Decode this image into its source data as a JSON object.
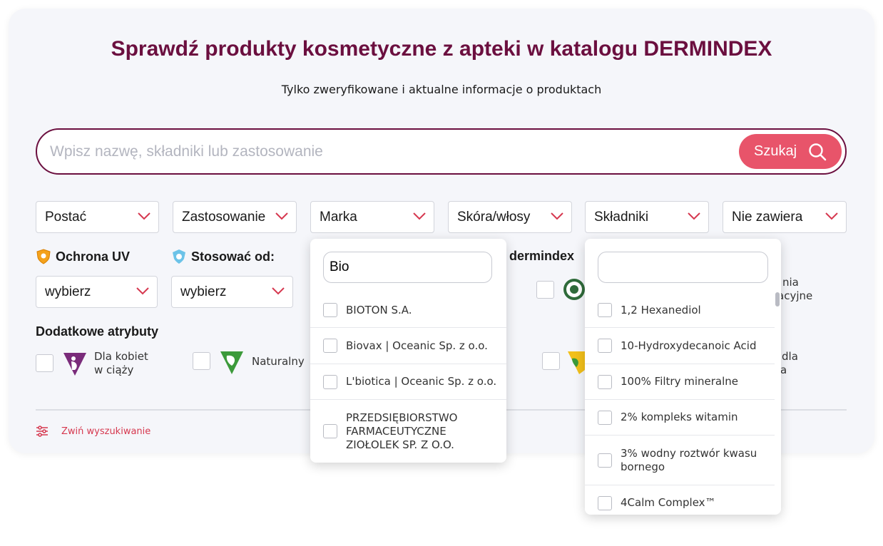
{
  "title": "Sprawdź produkty kosmetyczne z apteki w katalogu DERMINDEX",
  "subtitle": "Tylko zweryfikowane i aktualne informacje o produktach",
  "search": {
    "placeholder": "Wpisz nazwę, składniki lub zastosowanie",
    "button_label": "Szukaj"
  },
  "filters": [
    "Postać",
    "Zastosowanie",
    "Marka",
    "Skóra/włosy",
    "Składniki",
    "Nie zawiera"
  ],
  "uv": {
    "label": "Ochrona UV",
    "value": "wybierz"
  },
  "age": {
    "label": "Stosować od:",
    "value": "wybierz"
  },
  "dermindex": {
    "label": "dermindex",
    "partial_line1": "nia",
    "partial_line2": "acyjne"
  },
  "extra": {
    "label": "Dodatkowe atrybuty",
    "pregnant": "Dla kobiet w ciąży",
    "natural": "Naturalny",
    "partial_line1": "dla",
    "partial_line2": "a"
  },
  "collapse_label": "Zwiń wyszukiwanie",
  "brand_dropdown": {
    "query": "Bio",
    "options": [
      "BIOTON S.A.",
      "Biovax | Oceanic Sp. z o.o.",
      "L'biotica | Oceanic Sp. z o.o.",
      "PRZEDSIĘBIORSTWO FARMACEUTYCZNE ZIOŁOLEK SP. Z O.O."
    ]
  },
  "ingredients_dropdown": {
    "query": "",
    "options": [
      "1,2 Hexanediol",
      "10-Hydroxydecanoic Acid",
      "100% Filtry mineralne",
      "2% kompleks witamin",
      "3% wodny roztwór kwasu bornego",
      "4Calm Complex™"
    ]
  },
  "colors": {
    "brand": "#6b0f3f",
    "accent": "#e8546a",
    "background": "#f5f6fa"
  }
}
